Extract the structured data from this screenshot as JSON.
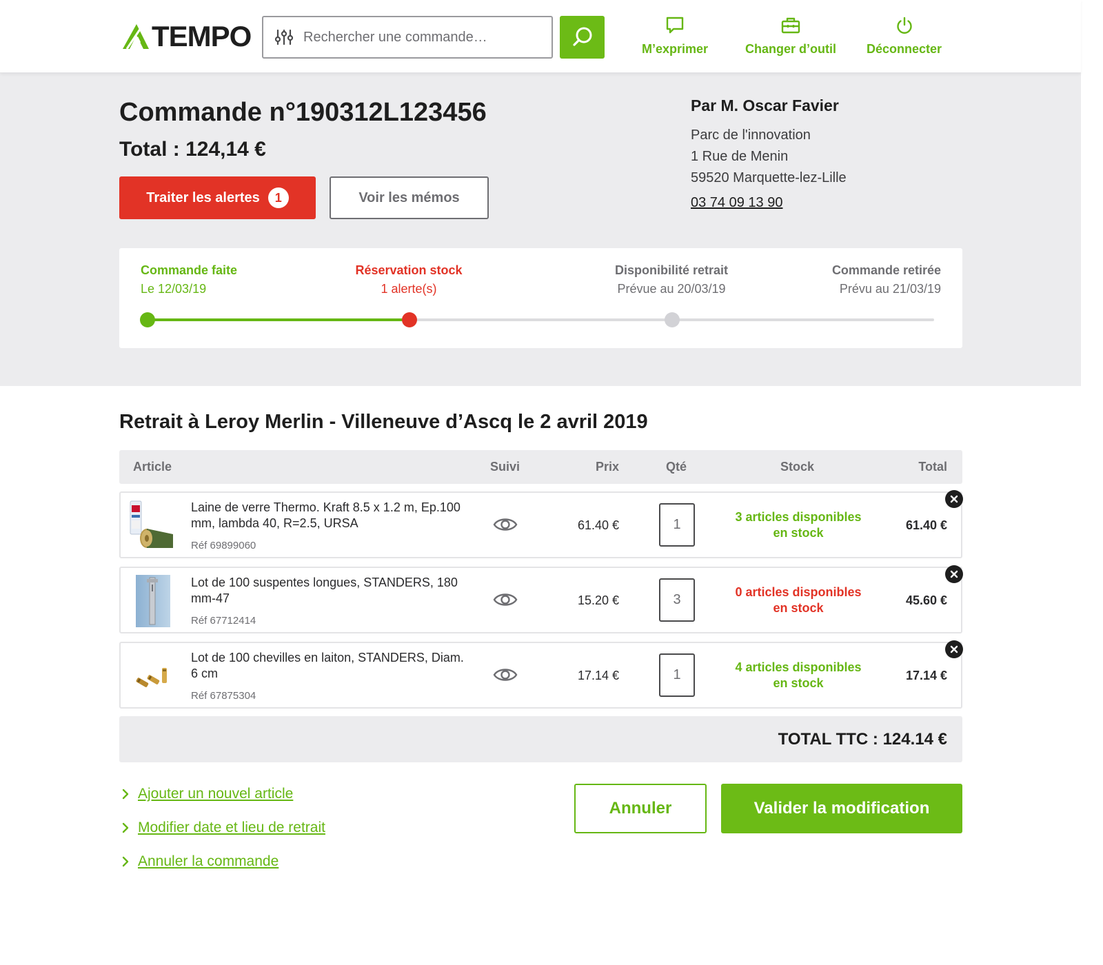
{
  "header": {
    "logo_text": "TEMPO",
    "search": {
      "placeholder": "Rechercher une commande…",
      "value": ""
    },
    "nav": [
      {
        "label": "M’exprimer",
        "icon": "speech-bubble-icon"
      },
      {
        "label": "Changer d’outil",
        "icon": "toolbox-icon"
      },
      {
        "label": "Déconnecter",
        "icon": "power-icon"
      }
    ]
  },
  "order": {
    "title": "Commande n°190312L123456",
    "total": "Total : 124,14 €",
    "alerts_button": "Traiter les alertes",
    "alerts_count": "1",
    "memos_button": "Voir les mémos"
  },
  "customer": {
    "name": "Par M. Oscar Favier",
    "address_line1": "Parc de l'innovation",
    "address_line2": "1 Rue de Menin",
    "address_line3": "59520 Marquette-lez-Lille",
    "phone": "03 74 09 13 90"
  },
  "progress": {
    "current_step": 2,
    "steps": [
      {
        "title": "Commande faite",
        "sub": "Le 12/03/19",
        "state": "done"
      },
      {
        "title": "Réservation stock",
        "sub": "1 alerte(s)",
        "state": "alert"
      },
      {
        "title": "Disponibilité retrait",
        "sub": "Prévue au 20/03/19",
        "state": "pending"
      },
      {
        "title": "Commande retirée",
        "sub": "Prévu au 21/03/19",
        "state": "pending"
      }
    ]
  },
  "pickup": {
    "title": "Retrait à Leroy Merlin - Villeneuve d’Ascq le 2 avril 2019"
  },
  "table": {
    "headers": {
      "article": "Article",
      "suivi": "Suivi",
      "prix": "Prix",
      "qte": "Qté",
      "stock": "Stock",
      "total": "Total"
    },
    "rows": [
      {
        "description": "Laine de verre Thermo. Kraft 8.5 x 1.2 m, Ep.100 mm, lambda 40, R=2.5, URSA",
        "ref": "Réf 69899060",
        "price": "61.40 €",
        "qty": "1",
        "stock_line1": "3 articles disponibles",
        "stock_line2": "en stock",
        "stock_status": "available",
        "total": "61.40 €",
        "thumb": "glass-wool-roll-image"
      },
      {
        "description": "Lot de 100 suspentes longues, STANDERS, 180 mm-47",
        "ref": "Réf 67712414",
        "price": "15.20 €",
        "qty": "3",
        "stock_line1": "0 articles disponibles",
        "stock_line2": "en stock",
        "stock_status": "unavailable",
        "total": "45.60 €",
        "thumb": "metal-hanger-image"
      },
      {
        "description": "Lot de 100 chevilles en laiton, STANDERS, Diam. 6 cm",
        "ref": "Réf 67875304",
        "price": "17.14 €",
        "qty": "1",
        "stock_line1": "4 articles disponibles",
        "stock_line2": "en stock",
        "stock_status": "available",
        "total": "17.14 €",
        "thumb": "brass-anchors-image"
      }
    ],
    "grand_total": "TOTAL TTC : 124.14 €"
  },
  "links": {
    "add_article": "Ajouter un nouvel article",
    "modify_pickup": "Modifier date et lieu de retrait",
    "cancel_order": "Annuler la commande"
  },
  "actions": {
    "cancel": "Annuler",
    "validate": "Valider la modification"
  },
  "colors": {
    "brand_green": "#66b714",
    "alert_red": "#e23326",
    "band_grey": "#ececee",
    "pending_grey": "#c8c8cc",
    "text_dark": "#1e1e1e",
    "text_muted": "#6e6e72"
  }
}
